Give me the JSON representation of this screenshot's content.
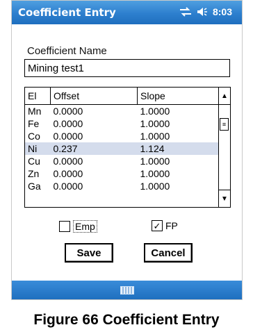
{
  "window": {
    "title": "Coefficient Entry",
    "status_icons": [
      "connectivity-icon",
      "volume-icon"
    ],
    "time": "8:03"
  },
  "coefficient_name": {
    "label": "Coefficient Name",
    "value": "Mining test1"
  },
  "grid": {
    "headers": [
      "El",
      "Offset",
      "Slope"
    ],
    "rows": [
      {
        "el": "Mn",
        "offset": "0.0000",
        "slope": "1.0000"
      },
      {
        "el": "Fe",
        "offset": "0.0000",
        "slope": "1.0000"
      },
      {
        "el": "Co",
        "offset": "0.0000",
        "slope": "1.0000"
      },
      {
        "el": "Ni",
        "offset": "0.237",
        "slope": "1.124"
      },
      {
        "el": "Cu",
        "offset": "0.0000",
        "slope": "1.0000"
      },
      {
        "el": "Zn",
        "offset": "0.0000",
        "slope": "1.0000"
      },
      {
        "el": "Ga",
        "offset": "0.0000",
        "slope": "1.0000"
      }
    ],
    "selected_row": 3
  },
  "checkboxes": {
    "emp": {
      "label": "Emp",
      "checked": false
    },
    "fp": {
      "label": "FP",
      "checked": true
    }
  },
  "buttons": {
    "save": "Save",
    "cancel": "Cancel"
  },
  "caption": "Figure 66 Coefficient Entry",
  "colors": {
    "titlebar": "#2d7fce",
    "selection": "#d4dcec"
  }
}
